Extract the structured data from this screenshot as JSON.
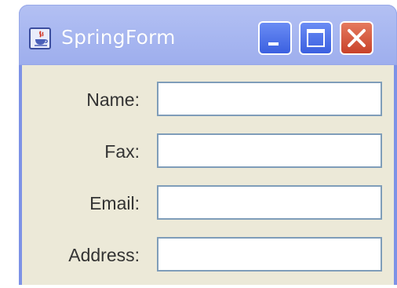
{
  "window": {
    "title": "SpringForm",
    "icon": "java-cup-icon",
    "controls": [
      "minimize-icon",
      "maximize-icon",
      "close-icon"
    ]
  },
  "form": {
    "fields": [
      {
        "label": "Name:",
        "value": ""
      },
      {
        "label": "Fax:",
        "value": ""
      },
      {
        "label": "Email:",
        "value": ""
      },
      {
        "label": "Address:",
        "value": ""
      }
    ]
  },
  "colors": {
    "titlebar": "#a9b8f1",
    "window_border": "#7d92e6",
    "close_button": "#c8422a",
    "body": "#ece9d8"
  }
}
